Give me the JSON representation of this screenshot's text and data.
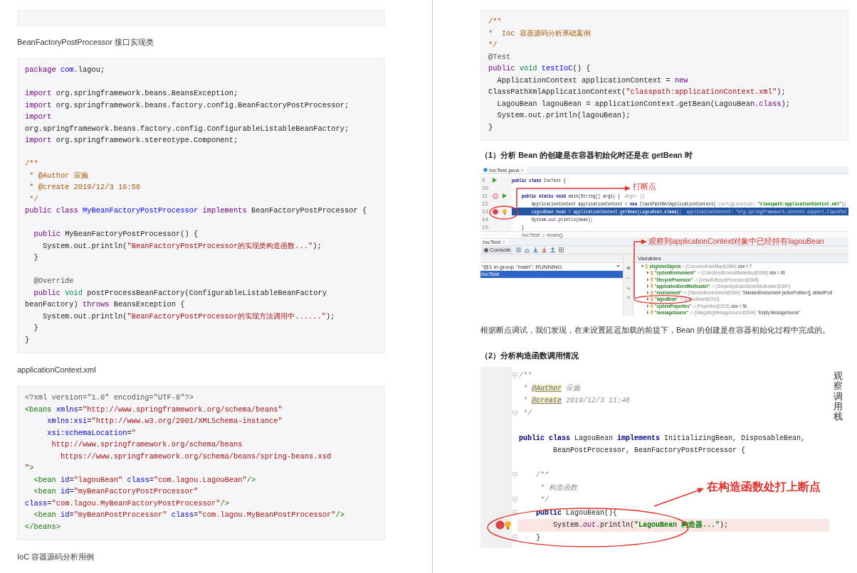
{
  "left_page": {
    "blocks": [
      {
        "kind": "code"
      },
      {
        "kind": "text",
        "text": "BeanFactoryPostProcessor 接口实现类"
      },
      {
        "kind": "code",
        "lines": [
          {
            "tokens": [
              {
                "kind": "kw",
                "text": "package "
              },
              {
                "kind": "def",
                "text": "com"
              },
              {
                "kind": "plain",
                "text": ".lagou;"
              }
            ]
          },
          {
            "gap": true,
            "tokens": [
              {
                "kind": "kw",
                "text": "import "
              },
              {
                "kind": "plain",
                "text": "org.springframework.beans.BeansException;"
              }
            ]
          },
          {
            "tokens": [
              {
                "kind": "kw",
                "text": "import "
              },
              {
                "kind": "plain",
                "text": "org.springframework.beans.factory.config.BeanFactoryPostProcessor;"
              }
            ]
          },
          {
            "tokens": [
              {
                "kind": "kw",
                "text": "import"
              }
            ]
          },
          {
            "tokens": [
              {
                "kind": "plain",
                "text": "org.springframework.beans.factory.config.ConfigurableListableBeanFactory;"
              }
            ]
          },
          {
            "tokens": [
              {
                "kind": "kw",
                "text": "import "
              },
              {
                "kind": "plain",
                "text": "org.springframework.stereotype.Component;"
              }
            ]
          },
          {
            "gap": true,
            "tokens": [
              {
                "kind": "com",
                "text": "/**"
              }
            ]
          },
          {
            "tokens": [
              {
                "kind": "com",
                "text": " * @Author 应癫"
              }
            ]
          },
          {
            "tokens": [
              {
                "kind": "com",
                "text": " * @create 2019/12/3 16:56"
              }
            ]
          },
          {
            "tokens": [
              {
                "kind": "com",
                "text": " */"
              }
            ]
          },
          {
            "tokens": [
              {
                "kind": "kw",
                "text": "public class "
              },
              {
                "kind": "def",
                "text": "MyBeanFactoryPostProcessor"
              },
              {
                "kind": "kw",
                "text": " implements "
              },
              {
                "kind": "plain",
                "text": "BeanFactoryPostProcessor {"
              }
            ]
          },
          {
            "gap": true,
            "tokens": [
              {
                "kind": "kw",
                "text": "  public "
              },
              {
                "kind": "plain",
                "text": "MyBeanFactoryPostProcessor() {"
              }
            ]
          },
          {
            "tokens": [
              {
                "kind": "plain",
                "text": "    System.out.println("
              },
              {
                "kind": "str",
                "text": "\"BeanFactoryPostProcessor的实现类构造函数...\""
              },
              {
                "kind": "plain",
                "text": ");"
              }
            ]
          },
          {
            "tokens": [
              {
                "kind": "plain",
                "text": "  }"
              }
            ]
          },
          {
            "gap": true,
            "tokens": [
              {
                "kind": "meta",
                "text": "  @Override"
              }
            ]
          },
          {
            "tokens": [
              {
                "kind": "kw",
                "text": "  public "
              },
              {
                "kind": "type",
                "text": "void "
              },
              {
                "kind": "plain",
                "text": "postProcessBeanFactory(ConfigurableListableBeanFactory"
              }
            ]
          },
          {
            "tokens": [
              {
                "kind": "plain",
                "text": "beanFactory) "
              },
              {
                "kind": "kw",
                "text": "throws "
              },
              {
                "kind": "plain",
                "text": "BeansException {"
              }
            ]
          },
          {
            "tokens": [
              {
                "kind": "plain",
                "text": "    System.out.println("
              },
              {
                "kind": "str",
                "text": "\"BeanFactoryPostProcessor的实现方法调用中......\""
              },
              {
                "kind": "plain",
                "text": ");"
              }
            ]
          },
          {
            "tokens": [
              {
                "kind": "plain",
                "text": "  }"
              }
            ]
          },
          {
            "tokens": [
              {
                "kind": "plain",
                "text": "}"
              }
            ]
          }
        ]
      },
      {
        "kind": "text",
        "text": "applicationContext.xml"
      },
      {
        "kind": "code",
        "lines": [
          {
            "tokens": [
              {
                "kind": "meta",
                "text": "<?xml version=\"1.0\" encoding=\"UTF-8\"?>"
              }
            ]
          },
          {
            "tokens": [
              {
                "kind": "tag",
                "text": "<beans "
              },
              {
                "kind": "attr",
                "text": "xmlns"
              },
              {
                "kind": "plain",
                "text": "="
              },
              {
                "kind": "str",
                "text": "\"http://www.springframework.org/schema/beans\""
              }
            ]
          },
          {
            "tokens": [
              {
                "kind": "attr",
                "text": "     xmlns:xsi"
              },
              {
                "kind": "plain",
                "text": "="
              },
              {
                "kind": "str",
                "text": "\"http://www.w3.org/2001/XMLSchema-instance\""
              }
            ]
          },
          {
            "tokens": [
              {
                "kind": "attr",
                "text": "     xsi:schemaLocation"
              },
              {
                "kind": "plain",
                "text": "="
              },
              {
                "kind": "str",
                "text": "\""
              }
            ]
          },
          {
            "tokens": [
              {
                "kind": "str",
                "text": "      http://www.springframework.org/schema/beans"
              }
            ]
          },
          {
            "tokens": [
              {
                "kind": "str",
                "text": "        https://www.springframework.org/schema/beans/spring-beans.xsd"
              }
            ]
          },
          {
            "tokens": [
              {
                "kind": "str",
                "text": "\""
              },
              {
                "kind": "tag",
                "text": ">"
              }
            ]
          },
          {
            "tokens": [
              {
                "kind": "tag",
                "text": "  <bean "
              },
              {
                "kind": "attr",
                "text": "id"
              },
              {
                "kind": "plain",
                "text": "="
              },
              {
                "kind": "str",
                "text": "\"lagouBean\" "
              },
              {
                "kind": "attr",
                "text": "class"
              },
              {
                "kind": "plain",
                "text": "="
              },
              {
                "kind": "str",
                "text": "\"com.lagou.LagouBean\""
              },
              {
                "kind": "tag",
                "text": "/>"
              }
            ]
          },
          {
            "tokens": [
              {
                "kind": "tag",
                "text": "  <bean "
              },
              {
                "kind": "attr",
                "text": "id"
              },
              {
                "kind": "plain",
                "text": "="
              },
              {
                "kind": "str",
                "text": "\"myBeanFactoryPostProcessor\""
              }
            ]
          },
          {
            "tokens": [
              {
                "kind": "attr",
                "text": "class"
              },
              {
                "kind": "plain",
                "text": "="
              },
              {
                "kind": "str",
                "text": "\"com.lagou.MyBeanFactoryPostProcessor\""
              },
              {
                "kind": "tag",
                "text": "/>"
              }
            ]
          },
          {
            "tokens": [
              {
                "kind": "tag",
                "text": "  <bean "
              },
              {
                "kind": "attr",
                "text": "id"
              },
              {
                "kind": "plain",
                "text": "="
              },
              {
                "kind": "str",
                "text": "\"myBeanPostProcessor\" "
              },
              {
                "kind": "attr",
                "text": "class"
              },
              {
                "kind": "plain",
                "text": "="
              },
              {
                "kind": "str",
                "text": "\"com.lagou.MyBeanPostProcessor\""
              },
              {
                "kind": "tag",
                "text": "/>"
              }
            ]
          },
          {
            "tokens": [
              {
                "kind": "tag",
                "text": "</beans>"
              }
            ]
          }
        ]
      },
      {
        "kind": "text",
        "text": "IoC 容器源码分析用例"
      }
    ]
  },
  "right_page": {
    "blocks": [
      {
        "kind": "code",
        "lines": [
          {
            "tokens": [
              {
                "kind": "com",
                "text": "/**"
              }
            ]
          },
          {
            "tokens": [
              {
                "kind": "com",
                "text": "*  Ioc 容器源码分析基础案例"
              }
            ]
          },
          {
            "tokens": [
              {
                "kind": "com",
                "text": "*/"
              }
            ]
          },
          {
            "tokens": [
              {
                "kind": "meta",
                "text": "@Test"
              }
            ]
          },
          {
            "tokens": [
              {
                "kind": "kw",
                "text": "public "
              },
              {
                "kind": "type",
                "text": "void "
              },
              {
                "kind": "def",
                "text": "testIoC"
              },
              {
                "kind": "plain",
                "text": "() {"
              }
            ]
          },
          {
            "tokens": [
              {
                "kind": "plain",
                "text": "  ApplicationContext applicationContext = "
              },
              {
                "kind": "kw",
                "text": "new"
              }
            ]
          },
          {
            "tokens": [
              {
                "kind": "plain",
                "text": "ClassPathXmlApplicationContext("
              },
              {
                "kind": "str",
                "text": "\"classpath:applicationContext.xml\""
              },
              {
                "kind": "plain",
                "text": ");"
              }
            ]
          },
          {
            "tokens": [
              {
                "kind": "plain",
                "text": "  LagouBean lagouBean = applicationContext.getBean(LagouBean."
              },
              {
                "kind": "kw",
                "text": "class"
              },
              {
                "kind": "plain",
                "text": ");"
              }
            ]
          },
          {
            "tokens": [
              {
                "kind": "plain",
                "text": "  System.out.println(lagouBean);"
              }
            ]
          },
          {
            "tokens": [
              {
                "kind": "plain",
                "text": "}"
              }
            ]
          }
        ]
      },
      {
        "kind": "heading",
        "text": "（1）分析 Bean 的创建是在容器初始化时还是在 getBean 时"
      },
      {
        "kind": "debugger_screenshot",
        "file_tab": "IocTest.java",
        "lines": [
          {
            "number": "9",
            "gutter_icons": [
              {
                "kind": "run"
              }
            ],
            "highlighted": false,
            "tokens": [
              {
                "kind": "kw",
                "text": "public class "
              },
              {
                "kind": "plain",
                "text": "IocTest {"
              }
            ]
          },
          {
            "number": "10",
            "highlighted": false
          },
          {
            "number": "11",
            "gutter_icons": [
              {
                "kind": "breakpoint-muted"
              },
              {
                "kind": "run"
              }
            ],
            "highlighted": false,
            "tokens": [
              {
                "kind": "kw",
                "text": "    public static void "
              },
              {
                "kind": "plain",
                "text": "main(String[] args) {  "
              },
              {
                "kind": "hint",
                "text": "args: {}"
              }
            ]
          },
          {
            "number": "12",
            "highlighted": false,
            "tokens": [
              {
                "kind": "plain",
                "text": "        ApplicationContext applicationContext = "
              },
              {
                "kind": "kw",
                "text": "new "
              },
              {
                "kind": "plain",
                "text": "ClassPathXmlApplicationContext( "
              },
              {
                "kind": "hint",
                "text": "configLocation:"
              },
              {
                "kind": "str",
                "text": " \"classpath:applicationContext.xml\""
              },
              {
                "kind": "plain",
                "text": ");"
              }
            ]
          },
          {
            "number": "13",
            "gutter_icons": [
              {
                "kind": "breakpoint"
              },
              {
                "kind": "bulb"
              }
            ],
            "highlighted": true,
            "tokens": [
              {
                "kind": "plain",
                "text": "        LagouBean bean = applicationContext.getBean(LagouBean."
              },
              {
                "kind": "kw",
                "text": "class"
              },
              {
                "kind": "plain",
                "text": ");  "
              },
              {
                "kind": "hint",
                "text": "applicationContext: \"org.springframework.context.support.ClassPat"
              }
            ]
          },
          {
            "number": "14",
            "highlighted": false,
            "tokens": [
              {
                "kind": "plain",
                "text": "        System."
              },
              {
                "kind": "static",
                "text": "out"
              },
              {
                "kind": "plain",
                "text": ".println(bean);"
              }
            ]
          },
          {
            "number": "15",
            "highlighted": false,
            "tokens": [
              {
                "kind": "plain",
                "text": "    }"
              }
            ]
          }
        ],
        "breadcrumb": [
          "IocTest",
          "main()"
        ],
        "debug_tab": "IocTest",
        "console_tab": "Console",
        "thread": "\"@1 in group \"main\": RUNNING",
        "frames": [
          {
            "label": "IocTest",
            "selected": true
          }
        ],
        "variables_title": "Variables",
        "variables": [
          {
            "name": "singletonObjects",
            "value": "= {ConcurrentHashMap@2884}",
            "detail": "size = 7",
            "expanded": true,
            "children": [
              {
                "name": "\"systemEnvironment\"",
                "value": "-> {Collections$UnmodifiableMap@2908}",
                "detail": "size = 40",
                "expanded": false
              },
              {
                "name": "\"lifecycleProcessor\"",
                "value": "-> {DefaultLifecycleProcessor@2845}",
                "expanded": false
              },
              {
                "name": "\"applicationEventMulticaster\"",
                "value": "-> {SimpleApplicationEventMulticaster@2847}",
                "expanded": false
              },
              {
                "name": "\"environment\"",
                "value": "-> {StandardEnvironment@2899}",
                "detail": "\"StandardEnvironment {activeProfiles=[], defaultProfi",
                "expanded": false
              },
              {
                "name": "\"lagouBean\"",
                "value": "-> {LagouBean@2913}",
                "expanded": false
              },
              {
                "name": "\"systemProperties\"",
                "value": "-> {Properties@2915}",
                "detail": "size = 56",
                "expanded": false
              },
              {
                "name": "\"messageSource\"",
                "value": "-> {DelegatingMessageSource@2846}",
                "detail": "\"Empty MessageSource\"",
                "expanded": false
              }
            ]
          }
        ],
        "annotations": [
          {
            "text": "打断点"
          },
          {
            "text": "观察到applicationContext对象中已经持有lagouBean"
          }
        ]
      },
      {
        "kind": "text",
        "text": "根据断点调试，我们发现，在未设置延迟加载的前提下，Bean 的创建是在容器初始化过程中完成的。"
      },
      {
        "kind": "heading",
        "text": "（2）分析构造函数调用情况"
      },
      {
        "kind": "editor_screenshot",
        "lines": [
          {
            "fold": true,
            "highlighted": false,
            "tokens": [
              {
                "kind": "com",
                "text": "/**"
              }
            ]
          },
          {
            "fold": false,
            "highlighted": false,
            "tokens": [
              {
                "kind": "com",
                "text": " * "
              },
              {
                "kind": "doctag",
                "text": "@Author"
              },
              {
                "kind": "com",
                "text": " 应癫"
              }
            ]
          },
          {
            "fold": false,
            "highlighted": false,
            "tokens": [
              {
                "kind": "com",
                "text": " * "
              },
              {
                "kind": "doctag",
                "text": "@create"
              },
              {
                "kind": "com",
                "text": " 2019/12/3 11:46"
              }
            ]
          },
          {
            "fold": true,
            "highlighted": false,
            "tokens": [
              {
                "kind": "com",
                "text": " */"
              }
            ]
          },
          {
            "gap": true,
            "fold": false,
            "highlighted": false,
            "tokens": [
              {
                "kind": "kw",
                "text": "public class "
              },
              {
                "kind": "plain",
                "text": "LagouBean "
              },
              {
                "kind": "kw",
                "text": "implements "
              },
              {
                "kind": "plain",
                "text": "InitializingBean, DisposableBean,"
              }
            ]
          },
          {
            "fold": false,
            "highlighted": false,
            "tokens": [
              {
                "kind": "plain",
                "text": "        BeanPostProcessor, BeanFactoryPostProcessor {"
              }
            ]
          },
          {
            "gap": true,
            "fold": true,
            "highlighted": false,
            "tokens": [
              {
                "kind": "com",
                "text": "    /**"
              }
            ]
          },
          {
            "fold": false,
            "highlighted": false,
            "tokens": [
              {
                "kind": "com",
                "text": "     * 构造函数"
              }
            ]
          },
          {
            "fold": true,
            "highlighted": false,
            "tokens": [
              {
                "kind": "com",
                "text": "     */"
              }
            ]
          },
          {
            "fold": true,
            "highlighted": false,
            "tokens": [
              {
                "kind": "kw",
                "text": "    public "
              },
              {
                "kind": "plain",
                "text": "LagouBean(){"
              }
            ]
          },
          {
            "fold": false,
            "highlighted": true,
            "gutter_icons": [
              {
                "kind": "breakpoint"
              },
              {
                "kind": "bulb"
              }
            ],
            "tokens": [
              {
                "kind": "plain",
                "text": "        System."
              },
              {
                "kind": "static",
                "text": "out"
              },
              {
                "kind": "plain",
                "text": ".println("
              },
              {
                "kind": "str",
                "text": "\"LagouBean 构造器...\""
              },
              {
                "kind": "plain",
                "text": ");"
              }
            ]
          },
          {
            "fold": true,
            "highlighted": false,
            "tokens": [
              {
                "kind": "plain",
                "text": "    }"
              }
            ]
          }
        ],
        "annotations": [
          {
            "text": "在构造函数处打上断点"
          }
        ],
        "side_note": "观察调用栈"
      }
    ]
  }
}
